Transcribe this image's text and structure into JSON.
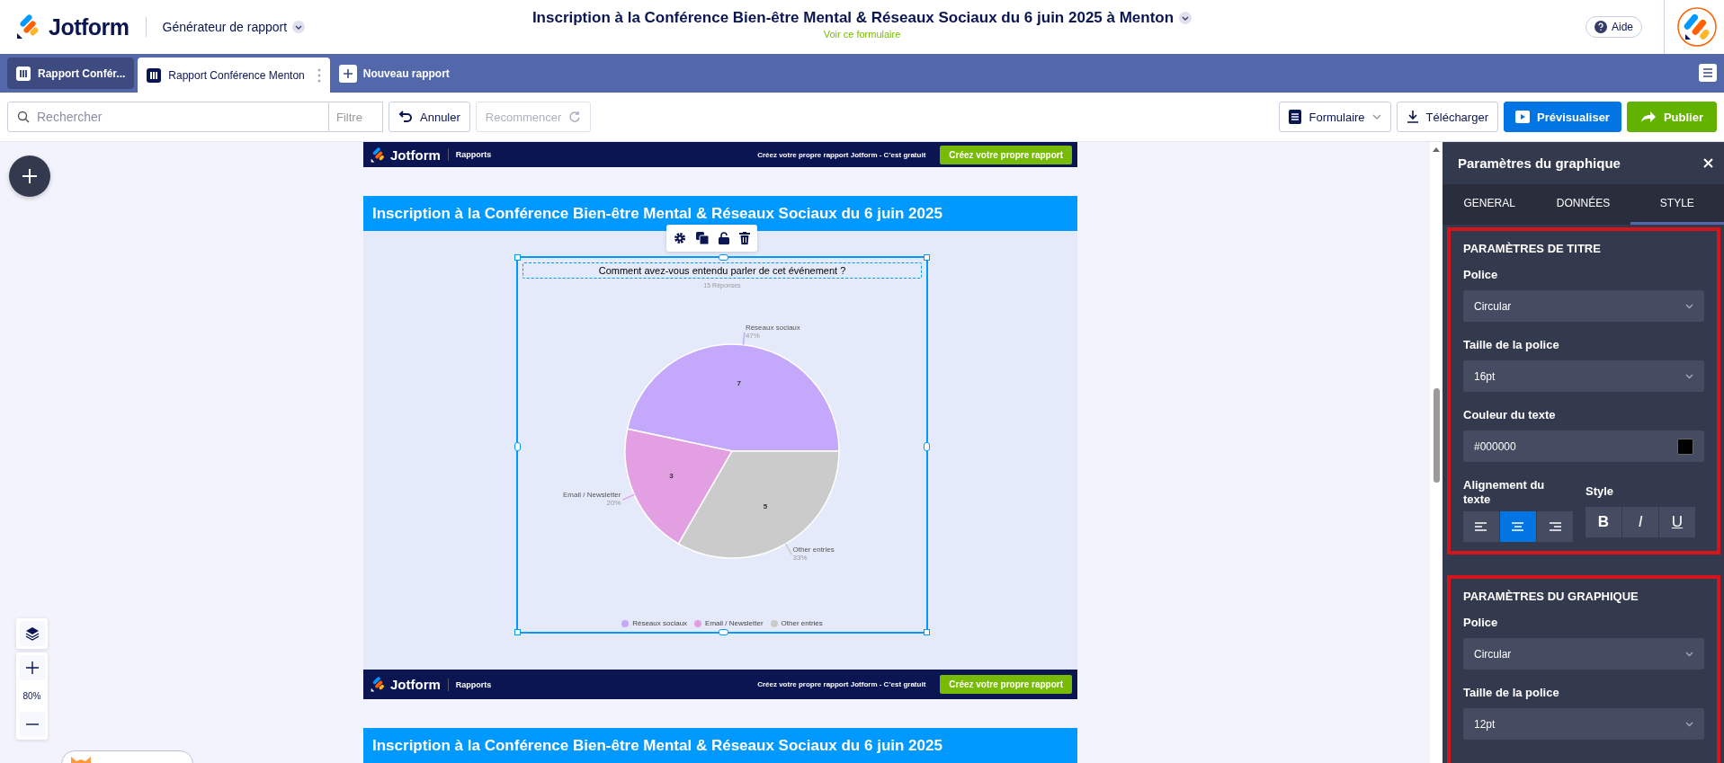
{
  "header": {
    "logo": "Jotform",
    "product": "Générateur de rapport",
    "title": "Inscription à la Conférence Bien-être Mental & Réseaux Sociaux du 6 juin 2025 à Menton",
    "form_link": "Voir ce formulaire",
    "help": "Aide"
  },
  "tabs": [
    {
      "label": "Rapport Confér...",
      "selected": false
    },
    {
      "label": "Rapport Conférence Menton",
      "selected": true
    }
  ],
  "new_report": "Nouveau rapport",
  "toolbar": {
    "search": {
      "placeholder": "Rechercher"
    },
    "filter": "Filtre",
    "undo": {
      "label": "Annuler",
      "disabled": false
    },
    "redo": {
      "label": "Recommencer",
      "disabled": true
    },
    "form_menu": "Formulaire",
    "download": "Télécharger",
    "preview": "Prévisualiser",
    "publish": "Publier"
  },
  "zoom": {
    "level": "80%"
  },
  "report": {
    "blocks": [
      {
        "kind": "banner",
        "logo": "Jotform",
        "section": "Rapports",
        "promo": "Créez votre propre rapport Jotform - C’est gratuit",
        "cta": "Créez votre propre rapport"
      },
      {
        "kind": "heading",
        "text": "Inscription à la Conférence Bien-être Mental & Réseaux Sociaux du 6 juin 2025"
      },
      {
        "kind": "chart",
        "selected": true,
        "title": "Comment avez-vous entendu parler de cet événement ?",
        "responses": "15 Réponses",
        "percents": [
          "47%",
          "20%",
          "33%"
        ],
        "legend": [
          {
            "label": "Réseaux sociaux",
            "color": "#c4a8fc"
          },
          {
            "label": "Email / Newsletter",
            "color": "#e2a0e3"
          },
          {
            "label": "Other entries",
            "color": "#cbcbcb"
          }
        ],
        "chart_data": {
          "type": "pie",
          "categories": [
            "Réseaux sociaux",
            "Email / Newsletter",
            "Other entries"
          ],
          "values": [
            7,
            3,
            5
          ],
          "data_labels": true
        }
      },
      {
        "kind": "banner",
        "logo": "Jotform",
        "section": "Rapports",
        "promo": "Créez votre propre rapport Jotform - C’est gratuit",
        "cta": "Créez votre propre rapport"
      },
      {
        "kind": "heading",
        "text": "Inscription à la Conférence Bien-être Mental & Réseaux Sociaux du 6 juin 2025"
      }
    ]
  },
  "settings": {
    "title": "Paramètres du graphique",
    "tabs": [
      {
        "label": "GENERAL",
        "selected": false
      },
      {
        "label": "DONNÉES",
        "selected": false
      },
      {
        "label": "STYLE",
        "selected": true
      }
    ],
    "sections": [
      {
        "heading": "PARAMÈTRES DE TITRE",
        "highlighted": true,
        "fields": [
          {
            "kind": "select",
            "label": "Police",
            "value": "Circular"
          },
          {
            "kind": "select",
            "label": "Taille de la police",
            "value": "16pt"
          },
          {
            "kind": "color",
            "label": "Couleur du texte",
            "value": "#000000"
          }
        ],
        "alignment": {
          "label": "Alignement du texte",
          "options": [
            {
              "kind": "left",
              "selected": false
            },
            {
              "kind": "center",
              "selected": true
            },
            {
              "kind": "right",
              "selected": false
            }
          ]
        },
        "style": {
          "label": "Style",
          "buttons": [
            "B",
            "I",
            "U"
          ]
        }
      },
      {
        "heading": "PARAMÈTRES DU GRAPHIQUE",
        "highlighted": true,
        "fields": [
          {
            "kind": "select",
            "label": "Police",
            "value": "Circular"
          },
          {
            "kind": "select",
            "label": "Taille de la police",
            "value": "12pt"
          }
        ]
      }
    ]
  }
}
